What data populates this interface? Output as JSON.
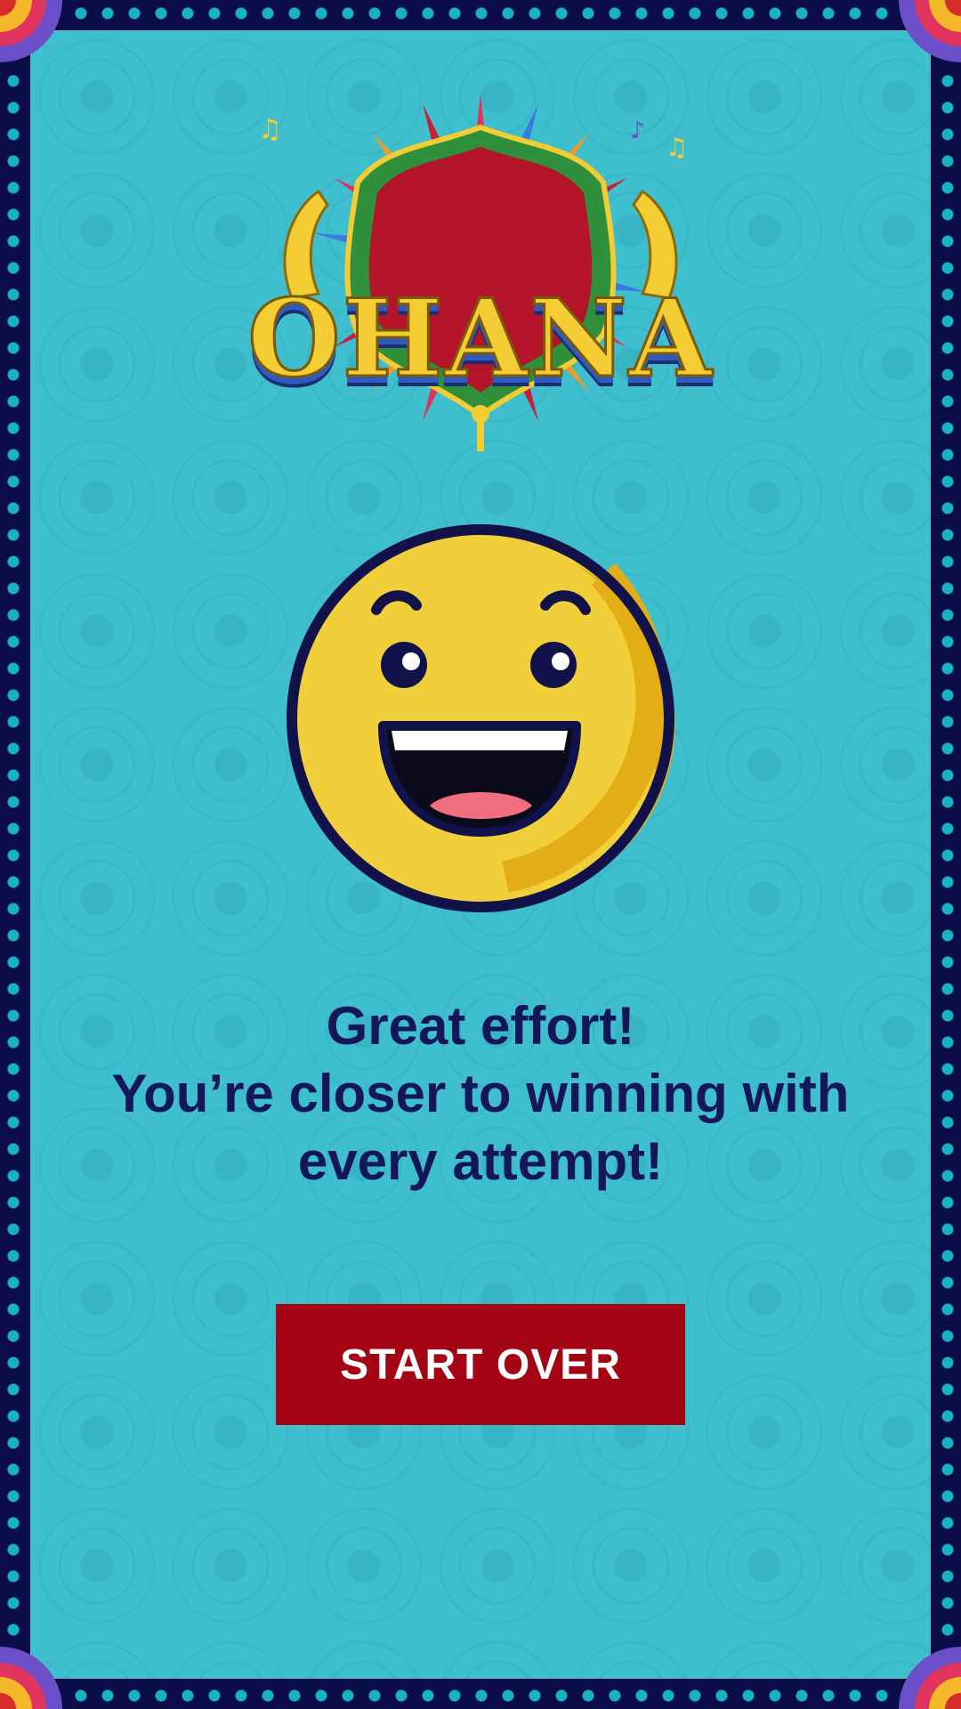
{
  "app": {
    "logo_text": "OHANA"
  },
  "result": {
    "emoji_icon": "happy-face-icon",
    "line1": "Great effort!",
    "line2": "You’re closer to winning with",
    "line3": "every attempt!"
  },
  "actions": {
    "start_over_label": "START OVER"
  },
  "colors": {
    "background": "#3fbecd",
    "frame": "#0b0d48",
    "text": "#14165a",
    "button": "#a30514",
    "emoji": "#f1cf3b"
  }
}
